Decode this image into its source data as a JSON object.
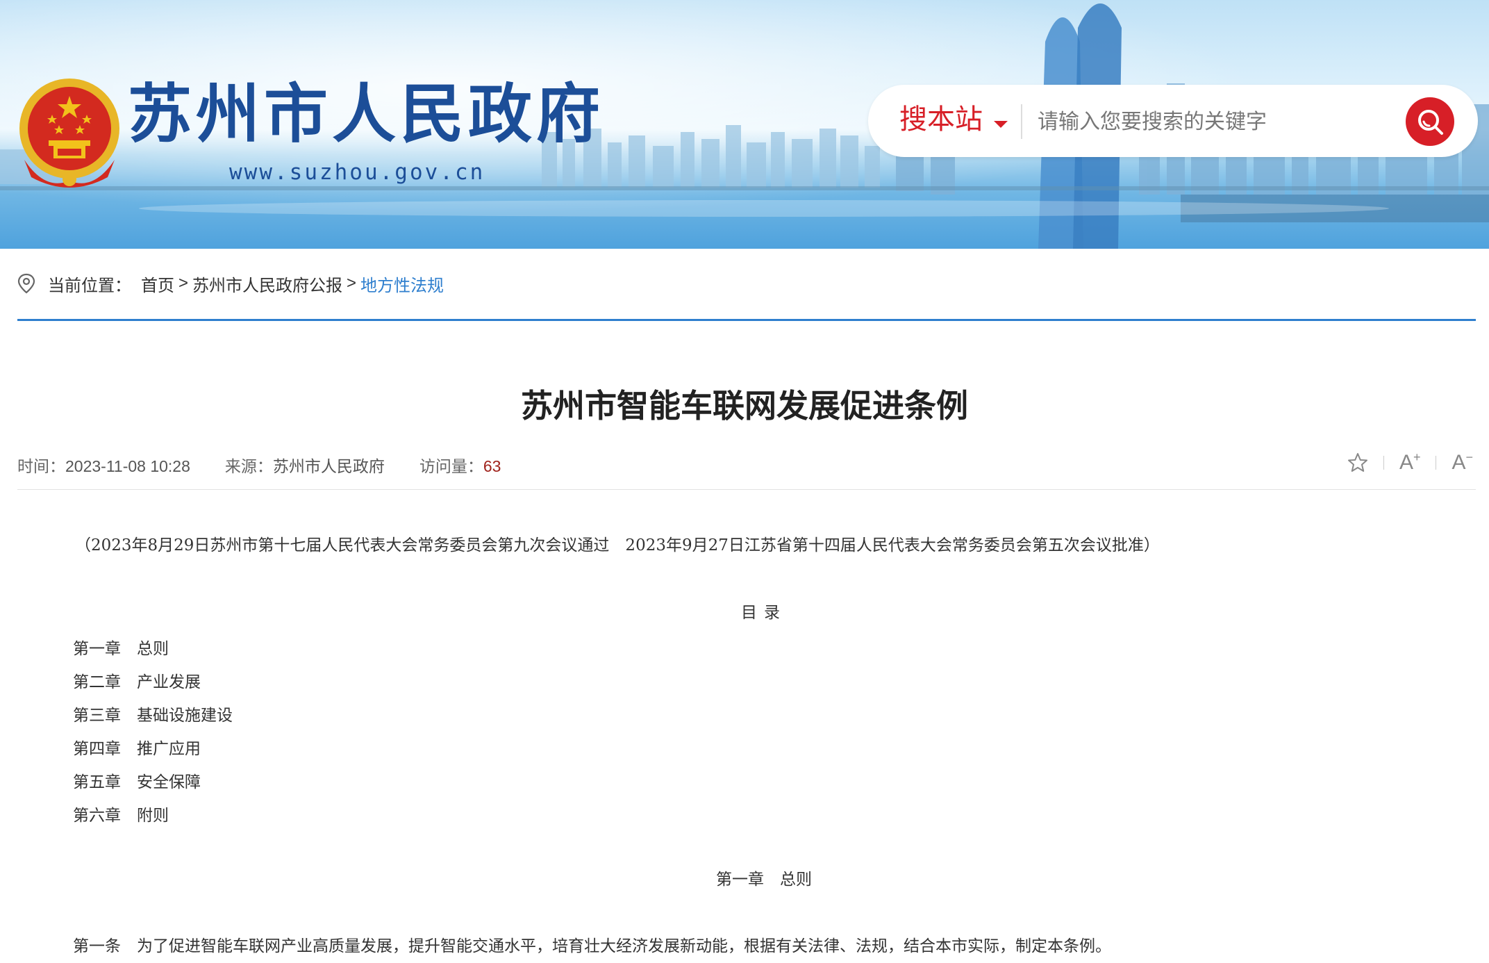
{
  "header": {
    "site_title": "苏州市人民政府",
    "site_url": "www.suzhou.gov.cn",
    "search": {
      "scope_label": "搜本站",
      "placeholder": "请输入您要搜索的关键字"
    }
  },
  "breadcrumb": {
    "label": "当前位置：",
    "items": [
      "首页",
      "苏州市人民政府公报",
      "地方性法规"
    ],
    "separator": ">"
  },
  "article": {
    "title": "苏州市智能车联网发展促进条例",
    "meta": {
      "time_label": "时间：",
      "time_value": "2023-11-08 10:28",
      "source_label": "来源：",
      "source_value": "苏州市人民政府",
      "visits_label": "访问量：",
      "visits_value": "63"
    },
    "tools": {
      "font_increase": "A",
      "font_increase_sup": "+",
      "font_decrease": "A",
      "font_decrease_sup": "−"
    },
    "note": "（2023年8月29日苏州市第十七届人民代表大会常务委员会第九次会议通过　2023年9月27日江苏省第十四届人民代表大会常务委员会第五次会议批准）",
    "toc_heading": "目录",
    "toc": [
      "第一章　总则",
      "第二章　产业发展",
      "第三章　基础设施建设",
      "第四章　推广应用",
      "第五章　安全保障",
      "第六章　附则"
    ],
    "chapter1_heading": "第一章　总则",
    "article1": "第一条　为了促进智能车联网产业高质量发展，提升智能交通水平，培育壮大经济发展新动能，根据有关法律、法规，结合本市实际，制定本条例。"
  },
  "colors": {
    "brand_blue": "#1c4e98",
    "accent_red": "#d71f27",
    "link_blue": "#2f7fce",
    "visits_red": "#a0231c"
  },
  "icons": [
    "national-emblem-icon",
    "caret-down-icon",
    "search-icon",
    "location-pin-icon",
    "star-icon"
  ]
}
